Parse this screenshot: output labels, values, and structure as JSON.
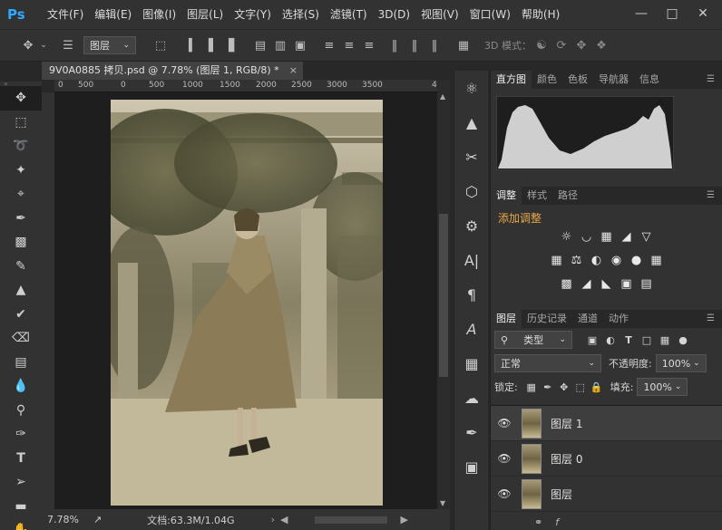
{
  "app": {
    "logo": "Ps",
    "menu": [
      "文件(F)",
      "编辑(E)",
      "图像(I)",
      "图层(L)",
      "文字(Y)",
      "选择(S)",
      "滤镜(T)",
      "3D(D)",
      "视图(V)",
      "窗口(W)",
      "帮助(H)"
    ]
  },
  "options": {
    "layer_select": "图层",
    "mode_3d": "3D 模式："
  },
  "document": {
    "tab_title": "9V0A0885 拷贝.psd @ 7.78% (图层 1, RGB/8) *",
    "ruler_ticks": [
      "0",
      "500",
      "0",
      "500",
      "1000",
      "1500",
      "2000",
      "2500",
      "3000",
      "3500",
      "4"
    ],
    "zoom": "7.78%",
    "doc_size": "文档:63.3M/1.04G"
  },
  "histogram_panel": {
    "tabs": [
      "直方图",
      "颜色",
      "色板",
      "导航器",
      "信息"
    ],
    "warning_icon": "warning-icon"
  },
  "adjust_panel": {
    "tabs": [
      "调整",
      "样式",
      "路径"
    ],
    "heading": "添加调整"
  },
  "layers_panel": {
    "tabs": [
      "图层",
      "历史记录",
      "通道",
      "动作"
    ],
    "filter_kind": "类型",
    "blend_mode": "正常",
    "opacity_label": "不透明度:",
    "opacity_value": "100%",
    "lock_label": "锁定:",
    "fill_label": "填充:",
    "fill_value": "100%",
    "layers": [
      {
        "name": "图层 1",
        "selected": true
      },
      {
        "name": "图层 0",
        "selected": false
      },
      {
        "name": "图层",
        "selected": false
      }
    ]
  },
  "colors": {
    "accent": "#31a8ff",
    "panel_bg": "#323232",
    "workspace_bg": "#282828"
  }
}
